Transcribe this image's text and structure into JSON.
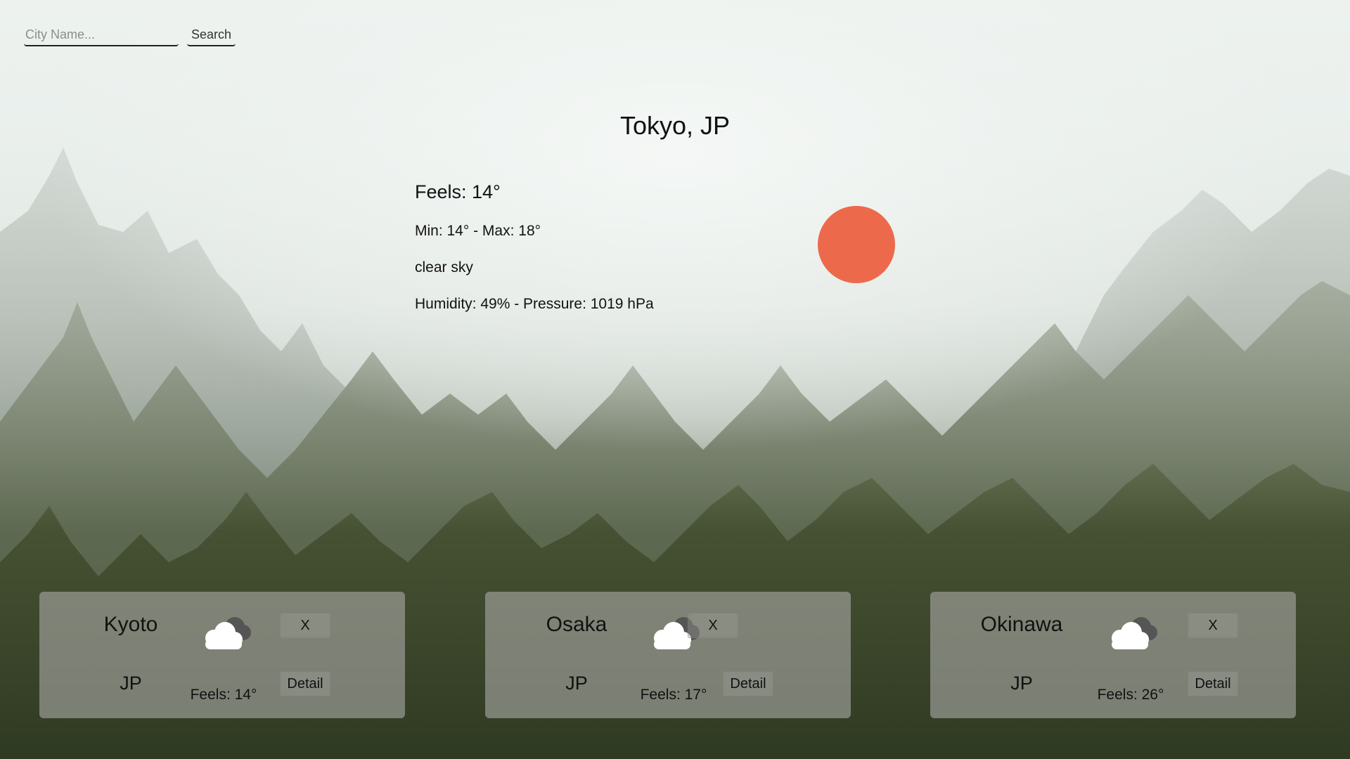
{
  "search": {
    "placeholder": "City Name...",
    "button_label": "Search"
  },
  "main": {
    "title": "Tokyo, JP",
    "feels": "Feels: 14°",
    "minmax": "Min: 14° - Max: 18°",
    "description": "clear sky",
    "humidity_pressure": "Humidity: 49% - Pressure: 1019 hPa",
    "icon": "sun-icon",
    "icon_color": "#ec6a4b"
  },
  "cards": [
    {
      "city": "Kyoto",
      "country": "JP",
      "feels": "Feels: 14°",
      "close_label": "X",
      "detail_label": "Detail",
      "icon": "cloud-icon"
    },
    {
      "city": "Osaka",
      "country": "JP",
      "feels": "Feels: 17°",
      "close_label": "X",
      "detail_label": "Detail",
      "icon": "cloud-icon"
    },
    {
      "city": "Okinawa",
      "country": "JP",
      "feels": "Feels: 26°",
      "close_label": "X",
      "detail_label": "Detail",
      "icon": "cloud-icon"
    }
  ]
}
